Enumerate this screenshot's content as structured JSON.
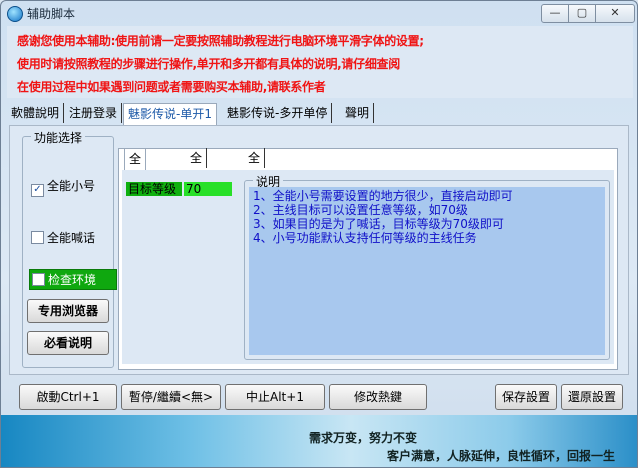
{
  "window": {
    "title": "辅助脚本",
    "min_glyph": "—",
    "max_glyph": "▢",
    "close_glyph": "✕"
  },
  "notices": [
    "感谢您使用本辅助:使用前请一定要按照辅助教程进行电脑环境平滑字体的设置;",
    "使用时请按照教程的步骤进行操作,单开和多开都有具体的说明,请仔细查阅",
    "在使用过程中如果遇到问题或者需要购买本辅助,请联系作者"
  ],
  "tabs": [
    "軟體說明",
    "注册登录",
    "魅影传说-单开1",
    "魅影传说-多开单停",
    "聲明"
  ],
  "function_group": {
    "title": "功能选择",
    "checkboxes": [
      {
        "label": "全能小号",
        "checked": true
      },
      {
        "label": "全能喊话",
        "checked": false
      },
      {
        "label": "检查环境",
        "checked": false
      }
    ],
    "browser_button": "专用浏览器",
    "help_button": "必看说明"
  },
  "inner_tabs": [
    "全能小号",
    "全能喊话",
    "全局设置及说明"
  ],
  "level": {
    "label": "目标等级",
    "value": "70"
  },
  "description": {
    "title": "说明",
    "lines": [
      "1、全能小号需要设置的地方很少，直接启动即可",
      "2、主线目标可以设置任意等级，如70级",
      "3、如果目的是为了喊话，目标等级为70级即可",
      "4、小号功能默认支持任何等级的主线任务"
    ]
  },
  "bottom_buttons": {
    "start": "啟動Ctrl+1",
    "pause": "暫停/繼續<無>",
    "stop": "中止Alt+1",
    "hotkey": "修改熱鍵",
    "save": "保存設置",
    "restore": "還原設置"
  },
  "footer": {
    "line1": "需求万变，努力不变",
    "line2": "客户满意，人脉延伸，良性循环，回报一生"
  },
  "colors": {
    "notice": "#f01414",
    "description_text": "#1010c8",
    "level_green": "#0fb00f"
  }
}
